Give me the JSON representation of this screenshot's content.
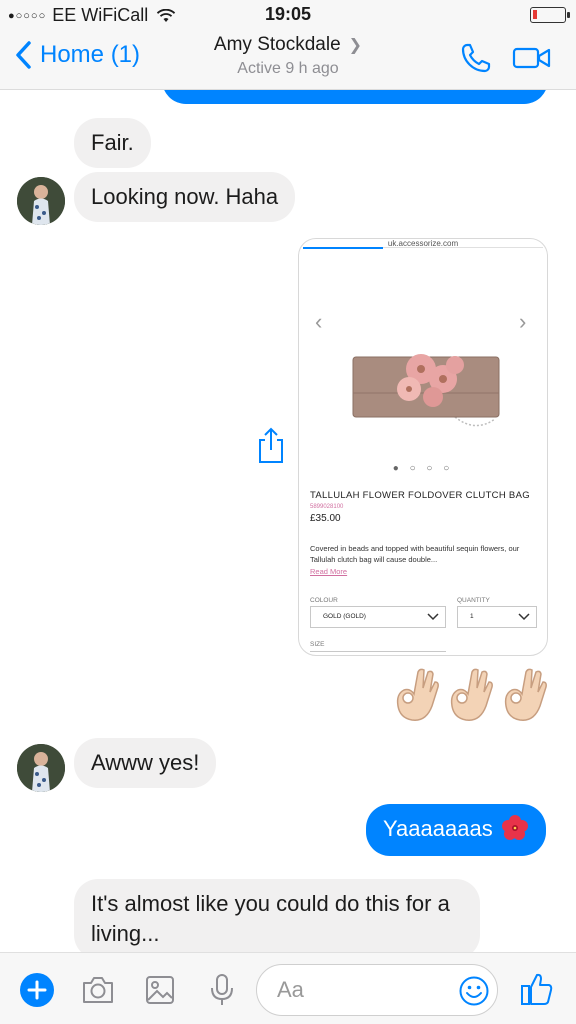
{
  "status_bar": {
    "signal": "●○○○○",
    "carrier": "EE WiFiCall",
    "time": "19:05"
  },
  "header": {
    "back_label": "Home (1)",
    "contact_name": "Amy Stockdale",
    "contact_status": "Active 9 h ago",
    "icons": [
      "back-chevron-icon",
      "call-icon",
      "video-call-icon"
    ]
  },
  "messages": [
    {
      "direction": "in",
      "text": "Fair."
    },
    {
      "direction": "in",
      "text": "Looking now. Haha"
    },
    {
      "direction": "out",
      "type": "link-card"
    },
    {
      "direction": "out",
      "type": "emoji",
      "emoji": "ok-hand",
      "count": 3
    },
    {
      "direction": "in",
      "text": "Awww yes!"
    },
    {
      "direction": "out",
      "text": "Yaaaaaaas",
      "emoji": "hibiscus"
    },
    {
      "direction": "in",
      "text": "It's almost like you could do this for a living..."
    }
  ],
  "link_card": {
    "url": "uk.accessorize.com",
    "carousel": "● ○ ○ ○",
    "product_name": "TALLULAH FLOWER FOLDOVER CLUTCH BAG",
    "product_code": "5899028100",
    "price": "£35.00",
    "description": "Covered in beads and topped with beautiful sequin flowers, our Tallulah clutch bag will cause double...",
    "read_more": "Read More",
    "colour_label": "COLOUR",
    "colour_value": "GOLD (GOLD)",
    "quantity_label": "QUANTITY",
    "quantity_value": "1",
    "size_label": "SIZE"
  },
  "composer": {
    "placeholder": "Aa",
    "icons": [
      "plus-icon",
      "camera-icon",
      "photo-icon",
      "microphone-icon",
      "emoji-icon",
      "thumbs-up-icon"
    ]
  },
  "colors": {
    "accent": "#0084ff",
    "incoming_bubble": "#f1f0f0",
    "battery_low": "#e53935"
  }
}
